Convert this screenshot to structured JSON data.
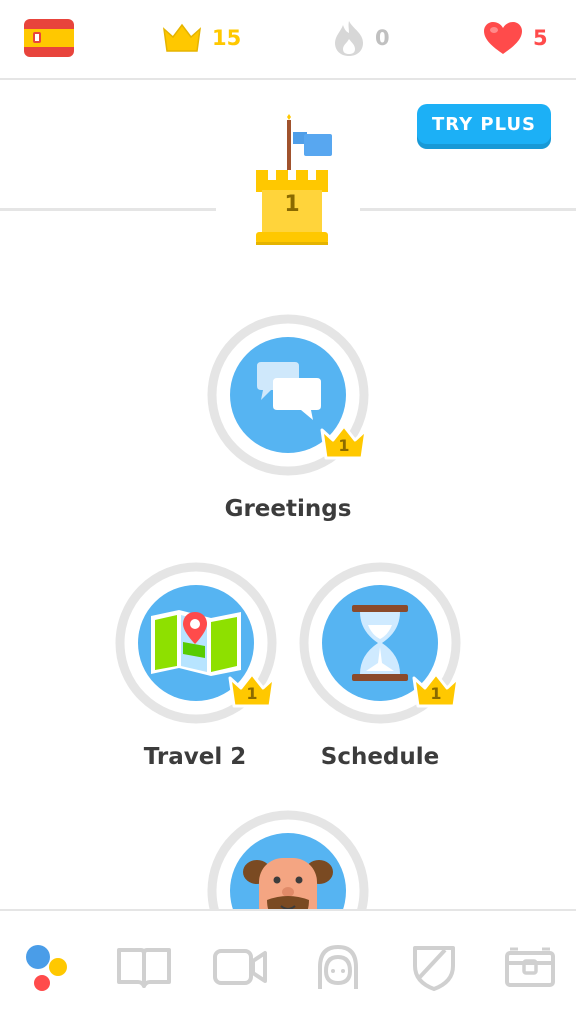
{
  "header": {
    "crowns": "15",
    "streak": "0",
    "hearts": "5"
  },
  "try_plus": "TRY PLUS",
  "checkpoint": {
    "level": "1"
  },
  "skills": [
    {
      "name": "Greetings",
      "crown_level": "1"
    },
    {
      "name": "Travel 2",
      "crown_level": "1"
    },
    {
      "name": "Schedule",
      "crown_level": "1"
    }
  ],
  "colors": {
    "gold": "#ffc800",
    "blue": "#1cb0f6",
    "skill_blue": "#56b4f2",
    "heart_red": "#ff4b4b",
    "gray": "#afafaf"
  },
  "icons": {
    "flag": "spain-flag-icon",
    "crown": "crown-icon",
    "streak": "flame-icon",
    "hearts": "heart-icon",
    "nav": [
      "learn-icon",
      "stories-icon",
      "video-icon",
      "profile-icon",
      "league-icon",
      "shop-icon"
    ]
  }
}
